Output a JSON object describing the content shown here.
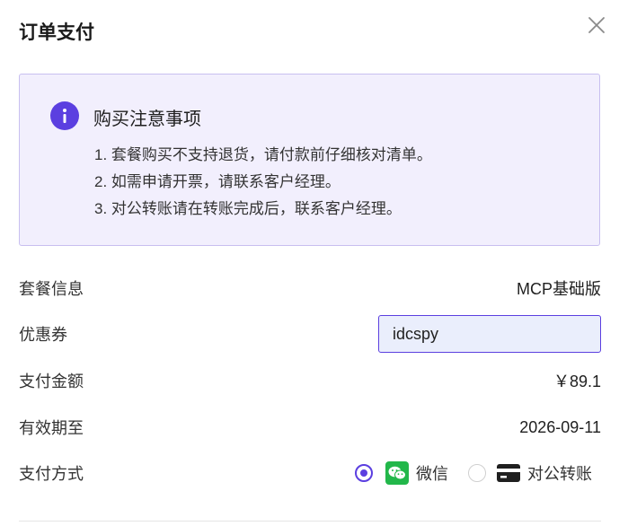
{
  "dialog": {
    "title": "订单支付"
  },
  "notice": {
    "icon": "info-icon",
    "title": "购买注意事项",
    "items": [
      "1. 套餐购买不支持退货，请付款前仔细核对清单。",
      "2. 如需申请开票，请联系客户经理。",
      "3. 对公转账请在转账完成后，联系客户经理。"
    ]
  },
  "fields": {
    "package_label": "套餐信息",
    "package_value": "MCP基础版",
    "coupon_label": "优惠券",
    "coupon_value": "idcspy",
    "amount_label": "支付金额",
    "amount_value": "￥89.1",
    "expiry_label": "有效期至",
    "expiry_value": "2026-09-11",
    "payment_label": "支付方式"
  },
  "payment": {
    "selected": "wechat",
    "wechat_label": "微信",
    "transfer_label": "对公转账"
  },
  "colors": {
    "accent": "#5b3fe0",
    "price": "#e5202e",
    "wechat": "#22b74a",
    "notice_bg": "#f2effd"
  }
}
